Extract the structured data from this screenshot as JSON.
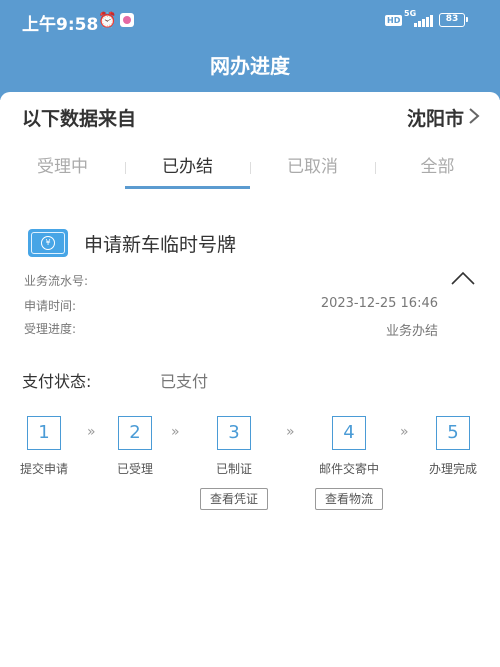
{
  "status_bar": {
    "time": "上午9:58",
    "alarm_icon": "alarm-clock-icon",
    "hd": "HD",
    "network": "5G",
    "battery": "83"
  },
  "header": {
    "title": "网办进度"
  },
  "source": {
    "label": "以下数据来自",
    "city": "沈阳市",
    "chevron_icon": "chevron-right-icon"
  },
  "tabs": [
    {
      "label": "受理中",
      "active": false
    },
    {
      "label": "已办结",
      "active": true
    },
    {
      "label": "已取消",
      "active": false
    },
    {
      "label": "全部",
      "active": false
    }
  ],
  "card": {
    "icon": "money-card-icon",
    "title": "申请新车临时号牌",
    "info": [
      {
        "label": "业务流水号:",
        "value": ""
      },
      {
        "label": "申请时间:",
        "value": "2023-12-25 16:46"
      },
      {
        "label": "受理进度:",
        "value": "业务办结"
      }
    ],
    "collapse_icon": "chevron-up-icon"
  },
  "payment": {
    "label": "支付状态:",
    "value": "已支付"
  },
  "steps": [
    {
      "number": "1",
      "label": "提交申请"
    },
    {
      "number": "2",
      "label": "已受理"
    },
    {
      "number": "3",
      "label": "已制证",
      "button": "查看凭证"
    },
    {
      "number": "4",
      "label": "邮件交寄中",
      "button": "查看物流"
    },
    {
      "number": "5",
      "label": "办理完成"
    }
  ],
  "step_separator": "»",
  "colors": {
    "header_blue": "#5b9bd0",
    "step_blue": "#4a9bd6",
    "icon_blue": "#47a5e6"
  }
}
